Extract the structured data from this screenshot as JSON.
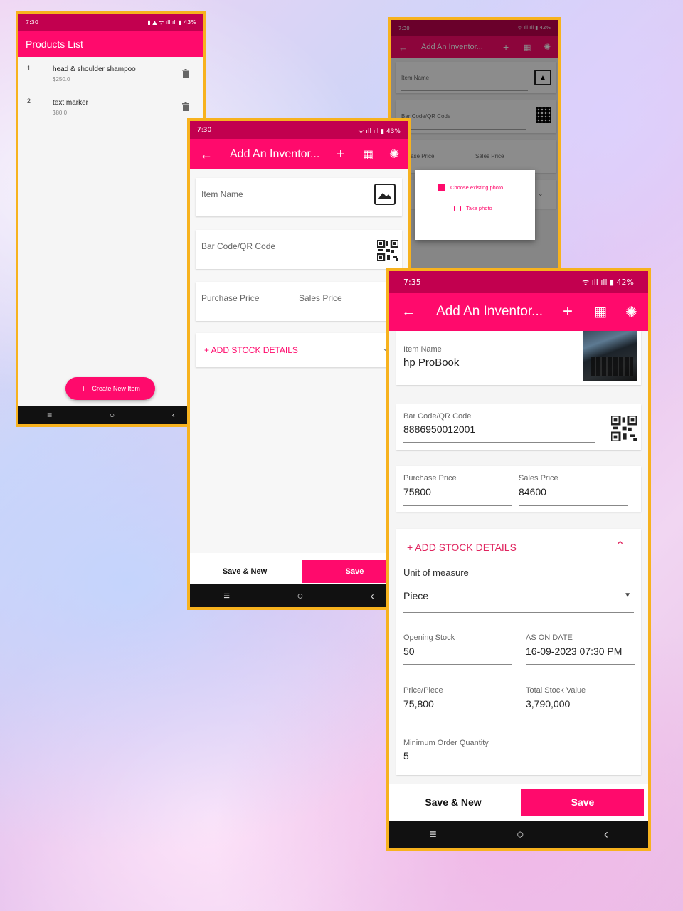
{
  "colors": {
    "accent": "#ff0a6c",
    "status": "#c2004f",
    "frame": "#f7b21e",
    "nav": "#111111"
  },
  "p1": {
    "time": "7:30",
    "battery": "43%",
    "title": "Products List",
    "items": [
      {
        "index": "1",
        "name": "head & shoulder shampoo",
        "price": "$250.0"
      },
      {
        "index": "2",
        "name": "text marker",
        "price": "$80.0"
      }
    ],
    "create_label": "Create New Item"
  },
  "p2": {
    "time": "7:30",
    "battery": "43%",
    "title": "Add An Inventor...",
    "item_name_placeholder": "Item Name",
    "barcode_placeholder": "Bar Code/QR Code",
    "purchase_placeholder": "Purchase Price",
    "sales_placeholder": "Sales Price",
    "stock_toggle": "+ ADD STOCK DETAILS",
    "save_new": "Save & New",
    "save": "Save"
  },
  "p3": {
    "time": "7:30",
    "battery": "42%",
    "title": "Add An Inventor...",
    "item_name_placeholder": "Item Name",
    "barcode_placeholder": "Bar Code/QR Code",
    "purchase_placeholder": "rchase Price",
    "sales_placeholder": "Sales Price",
    "choose_photo": "Choose existing photo",
    "take_photo": "Take photo"
  },
  "p4": {
    "time": "7:35",
    "battery": "42%",
    "title": "Add An Inventor...",
    "item_name_label": "Item Name",
    "item_name": "hp ProBook",
    "barcode_label": "Bar Code/QR Code",
    "barcode": "8886950012001",
    "purchase_label": "Purchase Price",
    "purchase": "75800",
    "sales_label": "Sales Price",
    "sales": "84600",
    "stock_toggle": "+ ADD STOCK DETAILS",
    "unit_label": "Unit of measure",
    "unit": "Piece",
    "opening_label": "Opening Stock",
    "opening": "50",
    "date_label": "AS ON DATE",
    "date": "16-09-2023 07:30 PM",
    "price_piece_label": "Price/Piece",
    "price_piece": "75,800",
    "total_label": "Total Stock Value",
    "total": "3,790,000",
    "min_label": "Minimum Order Quantity",
    "min": "5",
    "save_new": "Save & New",
    "save": "Save"
  }
}
